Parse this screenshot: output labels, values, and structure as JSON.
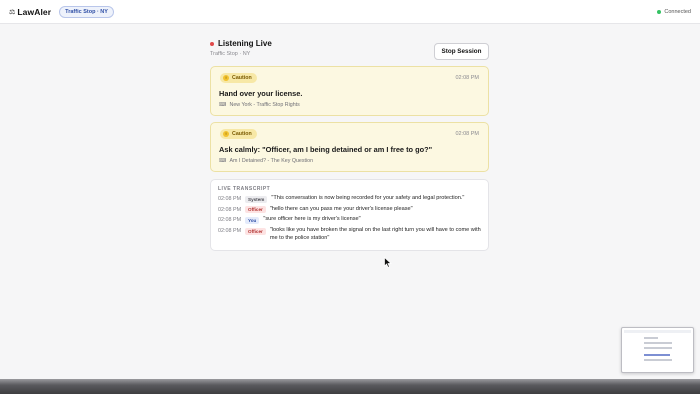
{
  "header": {
    "brand_icon": "⚖",
    "brand": "LawAler",
    "context_pill": "Traffic Stop · NY",
    "connection_status": "Connected",
    "status_color": "#34c263"
  },
  "session": {
    "title": "Listening Live",
    "subtitle": "Traffic Stop · NY",
    "stop_label": "Stop Session",
    "live_color": "#e0494a"
  },
  "cards": [
    {
      "badge": "Caution",
      "badge_icon": "!",
      "time": "02:08 PM",
      "text": "Hand over your license.",
      "source_icon": "⌨",
      "source": "New York - Traffic Stop Rights"
    },
    {
      "badge": "Caution",
      "badge_icon": "!",
      "time": "02:08 PM",
      "text": "Ask calmly: \"Officer, am I being detained or am I free to go?\"",
      "source_icon": "⌨",
      "source": "Am I Detained? - The Key Question"
    }
  ],
  "transcript": {
    "title": "LIVE TRANSCRIPT",
    "entries": [
      {
        "time": "02:08 PM",
        "speaker": "System",
        "text": "\"This conversation is now being recorded for your safety and legal protection.\""
      },
      {
        "time": "02:08 PM",
        "speaker": "Officer",
        "text": "\"hello there can you pass me your driver's license please\""
      },
      {
        "time": "02:08 PM",
        "speaker": "You",
        "text": "\"sure officer here is my driver's license\""
      },
      {
        "time": "02:08 PM",
        "speaker": "Officer",
        "text": "\"looks like you have broken the signal on the last right turn you will have to come with me to the police station\""
      }
    ]
  }
}
